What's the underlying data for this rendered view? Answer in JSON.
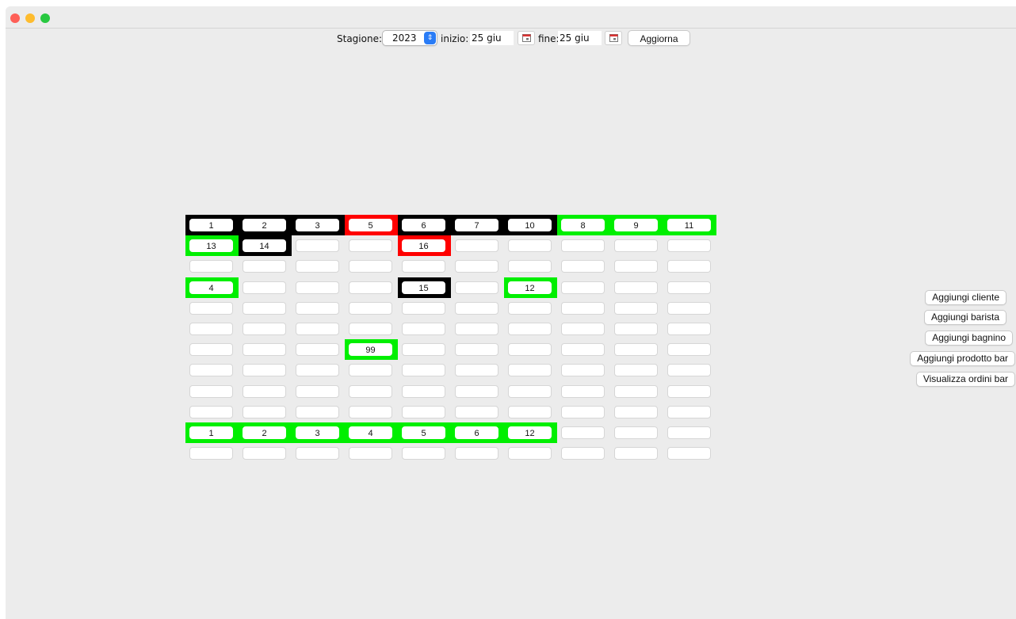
{
  "toolbar": {
    "season_label": "Stagione:",
    "season_value": "2023",
    "start_label": "inizio:",
    "start_value": "25 giu",
    "end_label": "fine:",
    "end_value": "25 giu",
    "update_label": "Aggiorna"
  },
  "colors": {
    "occupied": "#000000",
    "reserved": "#ff0000",
    "available": "#00ef00",
    "empty": "#ffffff"
  },
  "grid": [
    [
      {
        "label": "1",
        "status": "black"
      },
      {
        "label": "2",
        "status": "black"
      },
      {
        "label": "3",
        "status": "black"
      },
      {
        "label": "5",
        "status": "red"
      },
      {
        "label": "6",
        "status": "black"
      },
      {
        "label": "7",
        "status": "black"
      },
      {
        "label": "10",
        "status": "black"
      },
      {
        "label": "8",
        "status": "green"
      },
      {
        "label": "9",
        "status": "green"
      },
      {
        "label": "11",
        "status": "green"
      }
    ],
    [
      {
        "label": "13",
        "status": "green"
      },
      {
        "label": "14",
        "status": "black"
      },
      {
        "label": "",
        "status": "none"
      },
      {
        "label": "",
        "status": "none"
      },
      {
        "label": "16",
        "status": "red"
      },
      {
        "label": "",
        "status": "none"
      },
      {
        "label": "",
        "status": "none"
      },
      {
        "label": "",
        "status": "none"
      },
      {
        "label": "",
        "status": "none"
      },
      {
        "label": "",
        "status": "none"
      }
    ],
    [
      {
        "label": "",
        "status": "none"
      },
      {
        "label": "",
        "status": "none"
      },
      {
        "label": "",
        "status": "none"
      },
      {
        "label": "",
        "status": "none"
      },
      {
        "label": "",
        "status": "none"
      },
      {
        "label": "",
        "status": "none"
      },
      {
        "label": "",
        "status": "none"
      },
      {
        "label": "",
        "status": "none"
      },
      {
        "label": "",
        "status": "none"
      },
      {
        "label": "",
        "status": "none"
      }
    ],
    [
      {
        "label": "4",
        "status": "green"
      },
      {
        "label": "",
        "status": "none"
      },
      {
        "label": "",
        "status": "none"
      },
      {
        "label": "",
        "status": "none"
      },
      {
        "label": "15",
        "status": "black"
      },
      {
        "label": "",
        "status": "none"
      },
      {
        "label": "12",
        "status": "green"
      },
      {
        "label": "",
        "status": "none"
      },
      {
        "label": "",
        "status": "none"
      },
      {
        "label": "",
        "status": "none"
      }
    ],
    [
      {
        "label": "",
        "status": "none"
      },
      {
        "label": "",
        "status": "none"
      },
      {
        "label": "",
        "status": "none"
      },
      {
        "label": "",
        "status": "none"
      },
      {
        "label": "",
        "status": "none"
      },
      {
        "label": "",
        "status": "none"
      },
      {
        "label": "",
        "status": "none"
      },
      {
        "label": "",
        "status": "none"
      },
      {
        "label": "",
        "status": "none"
      },
      {
        "label": "",
        "status": "none"
      }
    ],
    [
      {
        "label": "",
        "status": "none"
      },
      {
        "label": "",
        "status": "none"
      },
      {
        "label": "",
        "status": "none"
      },
      {
        "label": "",
        "status": "none"
      },
      {
        "label": "",
        "status": "none"
      },
      {
        "label": "",
        "status": "none"
      },
      {
        "label": "",
        "status": "none"
      },
      {
        "label": "",
        "status": "none"
      },
      {
        "label": "",
        "status": "none"
      },
      {
        "label": "",
        "status": "none"
      }
    ],
    [
      {
        "label": "",
        "status": "none"
      },
      {
        "label": "",
        "status": "none"
      },
      {
        "label": "",
        "status": "none"
      },
      {
        "label": "99",
        "status": "green"
      },
      {
        "label": "",
        "status": "none"
      },
      {
        "label": "",
        "status": "none"
      },
      {
        "label": "",
        "status": "none"
      },
      {
        "label": "",
        "status": "none"
      },
      {
        "label": "",
        "status": "none"
      },
      {
        "label": "",
        "status": "none"
      }
    ],
    [
      {
        "label": "",
        "status": "none"
      },
      {
        "label": "",
        "status": "none"
      },
      {
        "label": "",
        "status": "none"
      },
      {
        "label": "",
        "status": "none"
      },
      {
        "label": "",
        "status": "none"
      },
      {
        "label": "",
        "status": "none"
      },
      {
        "label": "",
        "status": "none"
      },
      {
        "label": "",
        "status": "none"
      },
      {
        "label": "",
        "status": "none"
      },
      {
        "label": "",
        "status": "none"
      }
    ],
    [
      {
        "label": "",
        "status": "none"
      },
      {
        "label": "",
        "status": "none"
      },
      {
        "label": "",
        "status": "none"
      },
      {
        "label": "",
        "status": "none"
      },
      {
        "label": "",
        "status": "none"
      },
      {
        "label": "",
        "status": "none"
      },
      {
        "label": "",
        "status": "none"
      },
      {
        "label": "",
        "status": "none"
      },
      {
        "label": "",
        "status": "none"
      },
      {
        "label": "",
        "status": "none"
      }
    ],
    [
      {
        "label": "",
        "status": "none"
      },
      {
        "label": "",
        "status": "none"
      },
      {
        "label": "",
        "status": "none"
      },
      {
        "label": "",
        "status": "none"
      },
      {
        "label": "",
        "status": "none"
      },
      {
        "label": "",
        "status": "none"
      },
      {
        "label": "",
        "status": "none"
      },
      {
        "label": "",
        "status": "none"
      },
      {
        "label": "",
        "status": "none"
      },
      {
        "label": "",
        "status": "none"
      }
    ],
    [
      {
        "label": "1",
        "status": "green"
      },
      {
        "label": "2",
        "status": "green"
      },
      {
        "label": "3",
        "status": "green"
      },
      {
        "label": "4",
        "status": "green"
      },
      {
        "label": "5",
        "status": "green"
      },
      {
        "label": "6",
        "status": "green"
      },
      {
        "label": "12",
        "status": "green"
      },
      {
        "label": "",
        "status": "none"
      },
      {
        "label": "",
        "status": "none"
      },
      {
        "label": "",
        "status": "none"
      }
    ],
    [
      {
        "label": "",
        "status": "none"
      },
      {
        "label": "",
        "status": "none"
      },
      {
        "label": "",
        "status": "none"
      },
      {
        "label": "",
        "status": "none"
      },
      {
        "label": "",
        "status": "none"
      },
      {
        "label": "",
        "status": "none"
      },
      {
        "label": "",
        "status": "none"
      },
      {
        "label": "",
        "status": "none"
      },
      {
        "label": "",
        "status": "none"
      },
      {
        "label": "",
        "status": "none"
      }
    ]
  ],
  "side_actions": [
    {
      "label": "Aggiungi cliente"
    },
    {
      "label": "Aggiungi barista"
    },
    {
      "label": "Aggiungi bagnino"
    },
    {
      "label": "Aggiungi prodotto bar"
    },
    {
      "label": "Visualizza ordini bar"
    }
  ]
}
